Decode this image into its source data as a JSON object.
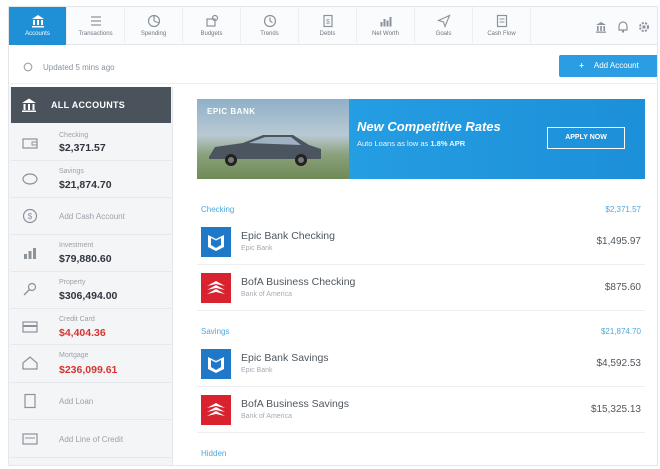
{
  "nav": {
    "tabs": [
      {
        "label": "Accounts",
        "icon": "bank-icon",
        "active": true
      },
      {
        "label": "Transactions",
        "icon": "list-icon"
      },
      {
        "label": "Spending",
        "icon": "pie-icon"
      },
      {
        "label": "Budgets",
        "icon": "budget-icon"
      },
      {
        "label": "Trends",
        "icon": "clock-icon"
      },
      {
        "label": "Debts",
        "icon": "document-icon"
      },
      {
        "label": "Net Worth",
        "icon": "bar-chart-icon"
      },
      {
        "label": "Goals",
        "icon": "paper-plane-icon"
      },
      {
        "label": "Cash Flow",
        "icon": "cashflow-icon"
      }
    ],
    "right_icons": [
      "bank-icon",
      "bell-icon",
      "gear-icon"
    ]
  },
  "status": {
    "text": "Updated 5 mins ago",
    "add_account_label": "Add Account"
  },
  "sidebar": {
    "header": "ALL ACCOUNTS",
    "items": [
      {
        "name": "Checking",
        "value": "$2,371.57",
        "icon": "wallet-icon"
      },
      {
        "name": "Savings",
        "value": "$21,874.70",
        "icon": "piggy-bank-icon"
      },
      {
        "add": "Add Cash Account",
        "icon": "dollar-circle-icon"
      },
      {
        "name": "Investment",
        "value": "$79,880.60",
        "icon": "growth-chart-icon"
      },
      {
        "name": "Property",
        "value": "$306,494.00",
        "icon": "key-icon"
      },
      {
        "name": "Credit Card",
        "value": "$4,404.36",
        "icon": "credit-card-icon",
        "negative": true
      },
      {
        "name": "Mortgage",
        "value": "$236,099.61",
        "icon": "house-icon",
        "negative": true
      },
      {
        "add": "Add Loan",
        "icon": "loan-doc-icon"
      },
      {
        "add": "Add Line of Credit",
        "icon": "credit-line-icon"
      }
    ]
  },
  "banner": {
    "brand": "EPIC BANK",
    "title": "New Competitive Rates",
    "subtitle_prefix": "Auto Loans as low as ",
    "subtitle_rate": "1.8% APR",
    "button": "APPLY NOW"
  },
  "sections": [
    {
      "name": "Checking",
      "total": "$2,371.57",
      "accounts": [
        {
          "title": "Epic Bank Checking",
          "bank": "Epic Bank",
          "amount": "$1,495.97",
          "logo": "epic-bank-logo-icon"
        },
        {
          "title": "BofA Business Checking",
          "bank": "Bank of America",
          "amount": "$875.60",
          "logo": "bofa-logo-icon"
        }
      ]
    },
    {
      "name": "Savings",
      "total": "$21,874.70",
      "accounts": [
        {
          "title": "Epic Bank Savings",
          "bank": "Epic Bank",
          "amount": "$4,592.53",
          "logo": "epic-bank-logo-icon"
        },
        {
          "title": "BofA Business Savings",
          "bank": "Bank of America",
          "amount": "$15,325.13",
          "logo": "bofa-logo-icon"
        }
      ]
    },
    {
      "name": "Hidden",
      "total": "",
      "accounts": []
    }
  ],
  "colors": {
    "accent": "#1f8fd6",
    "negative": "#d8342f",
    "epic_blue": "#1f78c8",
    "bofa_red": "#d8232f"
  }
}
